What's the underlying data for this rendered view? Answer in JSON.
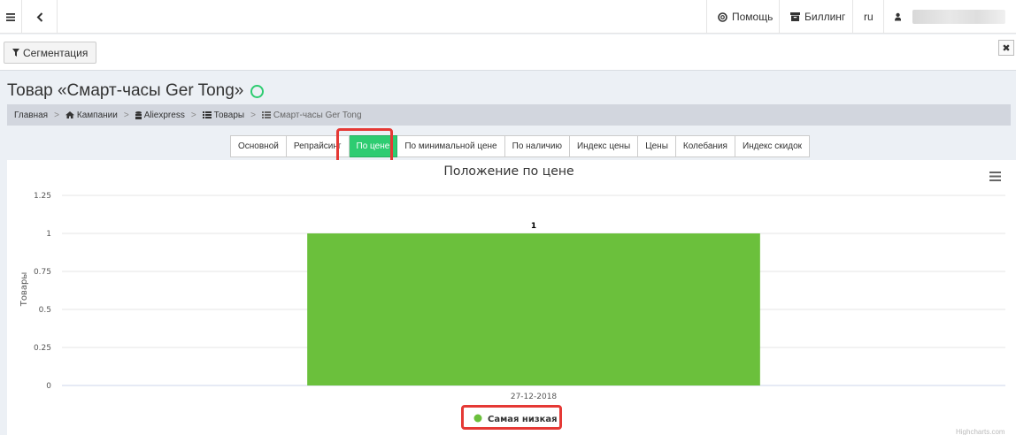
{
  "nav": {
    "help": "Помощь",
    "billing": "Биллинг",
    "lang": "ru"
  },
  "toolbar": {
    "segmentation": "Сегментация",
    "close": "✖"
  },
  "page": {
    "title": "Товар «Смарт-часы Ger Tong»"
  },
  "breadcrumbs": [
    "Главная",
    "Кампании",
    "Aliexpress",
    "Товары",
    "Смарт-часы Ger Tong"
  ],
  "tabs": [
    {
      "label": "Основной",
      "active": false
    },
    {
      "label": "Репрайсинг",
      "active": false
    },
    {
      "label": "По цене",
      "active": true
    },
    {
      "label": "По минимальной цене",
      "active": false
    },
    {
      "label": "По наличию",
      "active": false
    },
    {
      "label": "Индекс цены",
      "active": false
    },
    {
      "label": "Цены",
      "active": false
    },
    {
      "label": "Колебания",
      "active": false
    },
    {
      "label": "Индекс скидок",
      "active": false
    }
  ],
  "chart_data": {
    "type": "bar",
    "title": "Положение по цене",
    "ylabel": "Товары",
    "xlabel": "",
    "categories": [
      "27-12-2018"
    ],
    "series": [
      {
        "name": "Самая низкая",
        "values": [
          1
        ],
        "color": "#6bc03c"
      }
    ],
    "ylim": [
      0,
      1.25
    ],
    "yticks": [
      "0",
      "0.25",
      "0.5",
      "0.75",
      "1",
      "1.25"
    ],
    "data_labels": [
      "1"
    ],
    "grid": true,
    "legend": "bottom-center"
  },
  "credits": "Highcharts.com"
}
